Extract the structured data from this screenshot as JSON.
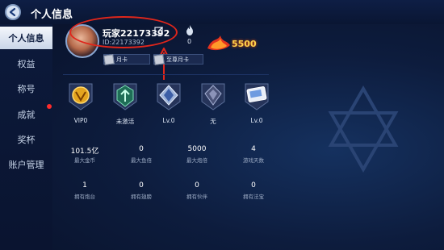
{
  "header": {
    "title": "个人信息"
  },
  "sidebar": {
    "items": [
      {
        "label": "个人信息"
      },
      {
        "label": "权益"
      },
      {
        "label": "称号"
      },
      {
        "label": "成就"
      },
      {
        "label": "奖杯"
      },
      {
        "label": "账户管理"
      }
    ]
  },
  "profile": {
    "name": "玩家22173392",
    "id_text": "ID:22173392",
    "fire_count": "0",
    "month_card": "月卡",
    "supreme_card": "至尊月卡",
    "power_value": "5500"
  },
  "honors": [
    {
      "label": "VIP0",
      "icon": "vip-badge-icon"
    },
    {
      "label": "未激活",
      "icon": "emblem-icon"
    },
    {
      "label": "Lv.0",
      "icon": "rank-badge-icon"
    },
    {
      "label": "无",
      "icon": "title-badge-icon"
    },
    {
      "label": "Lv.0",
      "icon": "card-badge-icon"
    }
  ],
  "stats_row1": [
    {
      "value": "101.5亿",
      "label": "最大金币"
    },
    {
      "value": "0",
      "label": "最大鱼倍"
    },
    {
      "value": "5000",
      "label": "最大炮倍"
    },
    {
      "value": "4",
      "label": "游戏天数"
    }
  ],
  "stats_row2": [
    {
      "value": "1",
      "label": "拥有炮台"
    },
    {
      "value": "0",
      "label": "拥有翅膀"
    },
    {
      "value": "0",
      "label": "拥有伙伴"
    },
    {
      "value": "0",
      "label": "拥有法宝"
    }
  ],
  "colors": {
    "accent": "#e0261b",
    "gold": "#ffd34d",
    "bg": "#0b1530"
  }
}
